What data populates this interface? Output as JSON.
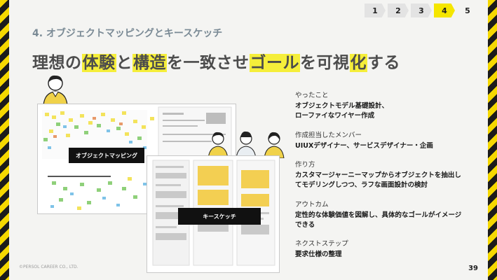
{
  "progress": {
    "steps": [
      "1",
      "2",
      "3",
      "4",
      "5"
    ],
    "active_step": "4"
  },
  "section_title": "4. オブジェクトマッピングとキースケッチ",
  "headline": {
    "p1": "理想の",
    "p2": "体験",
    "p3": "と",
    "p4": "構造",
    "p5": "を一致させ",
    "p6": "ゴール",
    "p7": "を可視",
    "p8": "化",
    "p9": "する"
  },
  "images": {
    "object_mapping_label": "オブジェクトマッピング",
    "key_sketch_label": "キースケッチ"
  },
  "details": [
    {
      "label": "やったこと",
      "value_lines": [
        "オブジェクトモデル基礎設計、",
        "ローファイなワイヤー作成"
      ]
    },
    {
      "label": "作成担当したメンバー",
      "value_lines": [
        "UIUXデザイナー、サービスデザイナー・企画"
      ]
    },
    {
      "label": "作り方",
      "value_lines": [
        "カスタマージャーニーマップからオブジェクトを抽出し",
        "てモデリングしつつ、ラフな画面設計の検討"
      ]
    },
    {
      "label": "アウトカム",
      "value_lines": [
        "定性的な体験価値を図解し、具体的なゴールがイメージ",
        "できる"
      ]
    },
    {
      "label": "ネクストステップ",
      "value_lines": [
        "要求仕様の整理"
      ]
    }
  ],
  "footer": {
    "copyright": "©PERSOL CAREER CO., LTD.",
    "page_number": "39"
  },
  "colors": {
    "highlight": "#f5ee3a",
    "step_active": "#f5e600",
    "stripe_yellow": "#f5d800",
    "stripe_dark": "#1b1b1b"
  }
}
